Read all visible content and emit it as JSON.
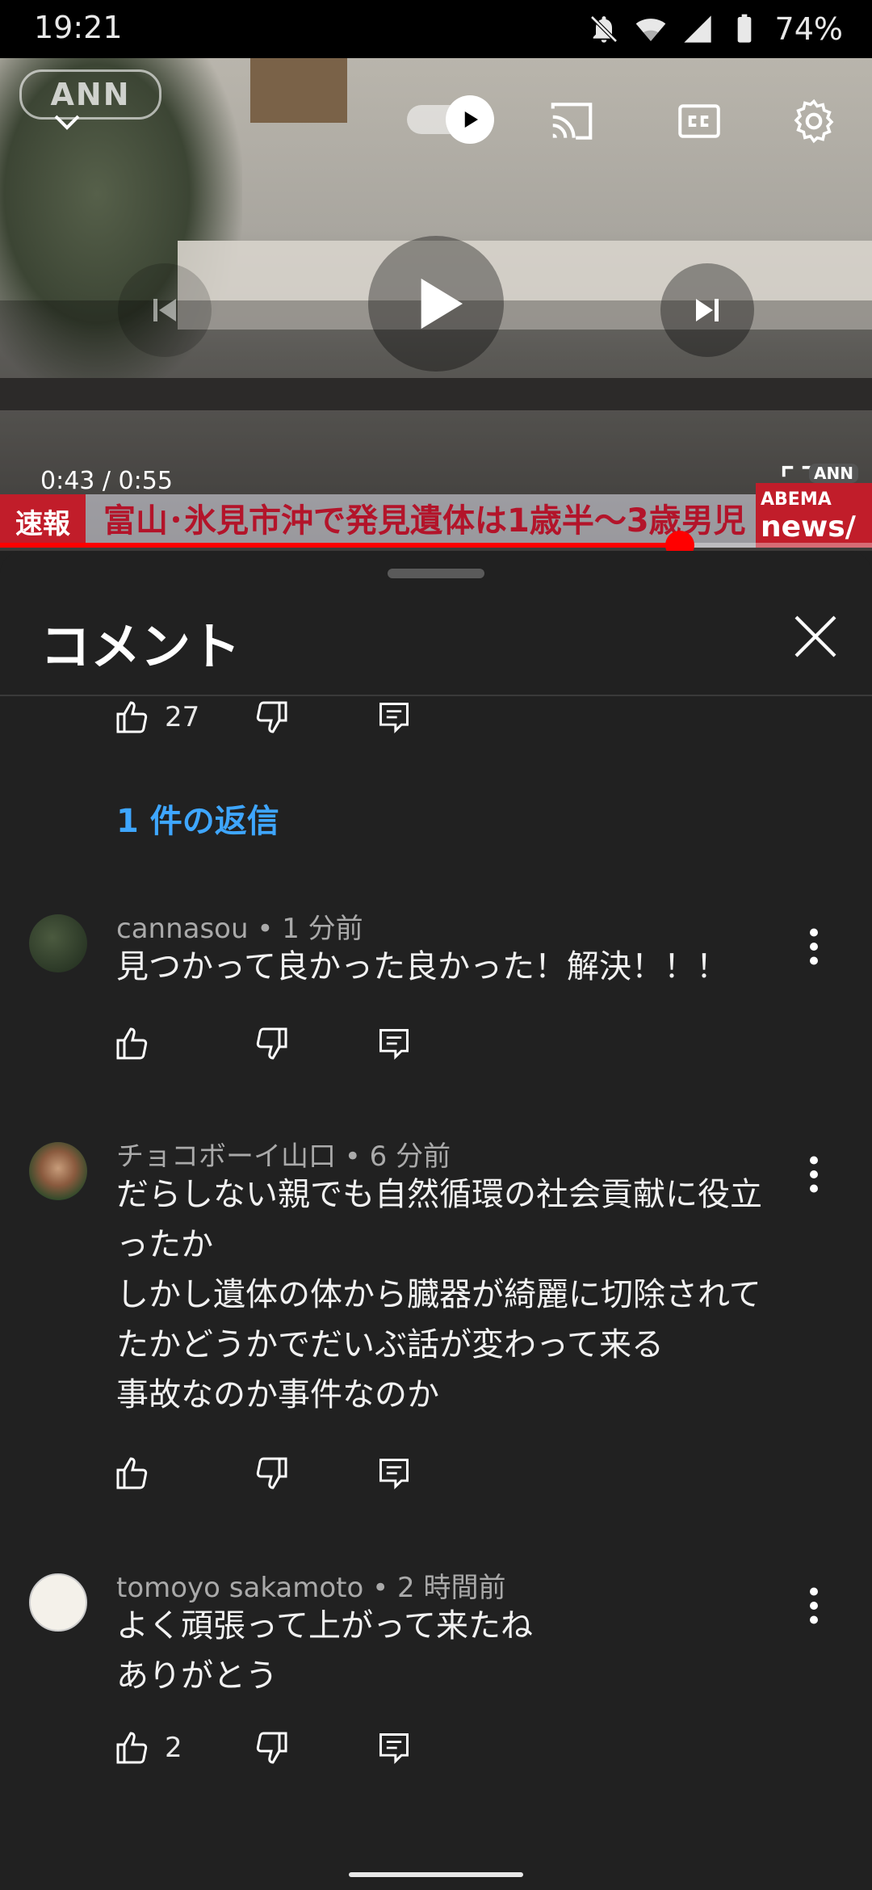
{
  "status_bar": {
    "time": "19:21",
    "battery": "74%",
    "icons": [
      "bell-off-icon",
      "wifi-icon",
      "signal-icon",
      "battery-icon"
    ]
  },
  "video": {
    "channel_logo": "ANN",
    "current_time": "0:43 / 0:55",
    "progress": 0.78,
    "ticker_tag": "速報",
    "ticker_text": "富山･氷見市沖で発見遺体は1歳半～3歳男児",
    "corner_logo_top": "ABEMA",
    "corner_logo_bottom": "news/",
    "corner_small_logo": "ANN",
    "controls": {
      "autoplay": "on",
      "icons": [
        "chevron-down-icon",
        "autoplay-toggle",
        "cast-icon",
        "captions-icon",
        "settings-icon",
        "previous-icon",
        "play-icon",
        "next-icon",
        "fullscreen-icon"
      ]
    }
  },
  "comments_panel": {
    "title": "コメント",
    "partial_comment": {
      "likes": "27"
    },
    "replies_link": "1 件の返信",
    "comments": [
      {
        "author": "cannasou",
        "time": "1 分前",
        "text": "見つかって良かった良かった！解決！！！",
        "likes": ""
      },
      {
        "author": "チョコボーイ山口",
        "time": "6 分前",
        "text": "だらしない親でも自然循環の社会貢献に役立\nったか\nしかし遺体の体から臓器が綺麗に切除されて\nたかどうかでだいぶ話が変わって来る\n事故なのか事件なのか",
        "likes": ""
      },
      {
        "author": "tomoyo sakamoto",
        "time": "2 時間前",
        "text": "よく頑張って上がって来たね\nありがとう",
        "likes": "2"
      }
    ],
    "separator": " • "
  },
  "colors": {
    "background": "#212121",
    "link_blue": "#3ea6ff",
    "progress_red": "#ff0000",
    "meta_gray": "#aaaaaa"
  }
}
